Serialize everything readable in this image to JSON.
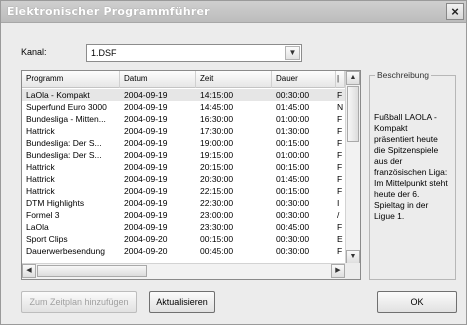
{
  "window": {
    "title": "Elektronischer Programmführer",
    "close_glyph": "×"
  },
  "kanal": {
    "label": "Kanal:",
    "value": "1.DSF",
    "arrow_icon": "chevron-down-icon"
  },
  "list": {
    "columns": [
      "Programm",
      "Datum",
      "Zeit",
      "Dauer",
      "|"
    ],
    "rows": [
      [
        "LaOla - Kompakt",
        "2004-09-19",
        "14:15:00",
        "00:30:00",
        "F"
      ],
      [
        "Superfund Euro 3000",
        "2004-09-19",
        "14:45:00",
        "01:45:00",
        "N"
      ],
      [
        "Bundesliga - Mitten...",
        "2004-09-19",
        "16:30:00",
        "01:00:00",
        "F"
      ],
      [
        "Hattrick",
        "2004-09-19",
        "17:30:00",
        "01:30:00",
        "F"
      ],
      [
        "Bundesliga: Der S...",
        "2004-09-19",
        "19:00:00",
        "00:15:00",
        "F"
      ],
      [
        "Bundesliga: Der S...",
        "2004-09-19",
        "19:15:00",
        "01:00:00",
        "F"
      ],
      [
        "Hattrick",
        "2004-09-19",
        "20:15:00",
        "00:15:00",
        "F"
      ],
      [
        "Hattrick",
        "2004-09-19",
        "20:30:00",
        "01:45:00",
        "F"
      ],
      [
        "Hattrick",
        "2004-09-19",
        "22:15:00",
        "00:15:00",
        "F"
      ],
      [
        "DTM Highlights",
        "2004-09-19",
        "22:30:00",
        "00:30:00",
        "I"
      ],
      [
        "Formel 3",
        "2004-09-19",
        "23:00:00",
        "00:30:00",
        "/"
      ],
      [
        "LaOla",
        "2004-09-19",
        "23:30:00",
        "00:45:00",
        "F"
      ],
      [
        "Sport Clips",
        "2004-09-20",
        "00:15:00",
        "00:30:00",
        "E"
      ],
      [
        "Dauerwerbesendung",
        "2004-09-20",
        "00:45:00",
        "00:30:00",
        "F"
      ]
    ],
    "selected_row": 0,
    "scroll": {
      "up": "▲",
      "down": "▼",
      "left": "◀",
      "right": "▶"
    }
  },
  "beschreibung": {
    "legend": "Beschreibung",
    "text": "Fußball LAOLA - Kompakt präsentiert heute die Spitzenspiele aus der französischen Liga: Im Mittelpunkt steht heute der 6. Spieltag in der Ligue 1."
  },
  "buttons": {
    "add": "Zum Zeitplan hinzufügen",
    "refresh": "Aktualisieren",
    "ok": "OK"
  }
}
